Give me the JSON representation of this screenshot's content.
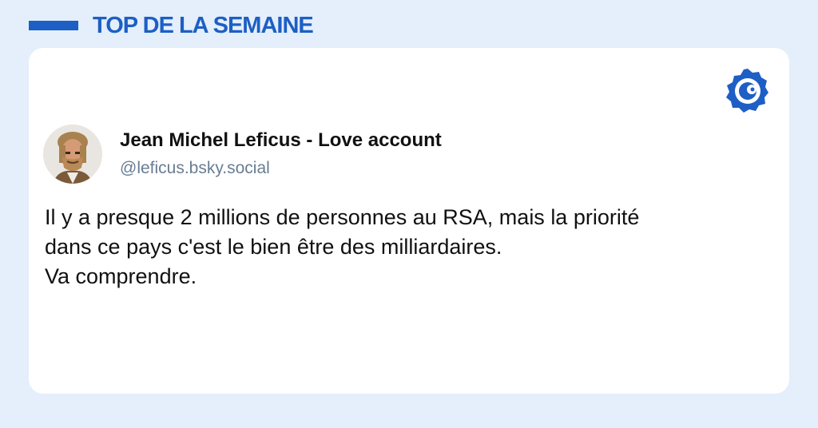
{
  "header": {
    "title": "TOP DE LA SEMAINE"
  },
  "card": {
    "logo_icon": "bluesky-butterfly-icon",
    "author": {
      "name": "Jean Michel Leficus - Love account",
      "handle": "@leficus.bsky.social"
    },
    "text_lines": [
      "Il y a presque 2 millions de personnes au RSA, mais la priorité",
      "dans ce pays c'est le bien être des milliardaires.",
      "Va comprendre."
    ]
  },
  "colors": {
    "background": "#e4effb",
    "accent": "#1d5fc4",
    "card": "#ffffff",
    "handle": "#687d93",
    "text": "#111111"
  }
}
